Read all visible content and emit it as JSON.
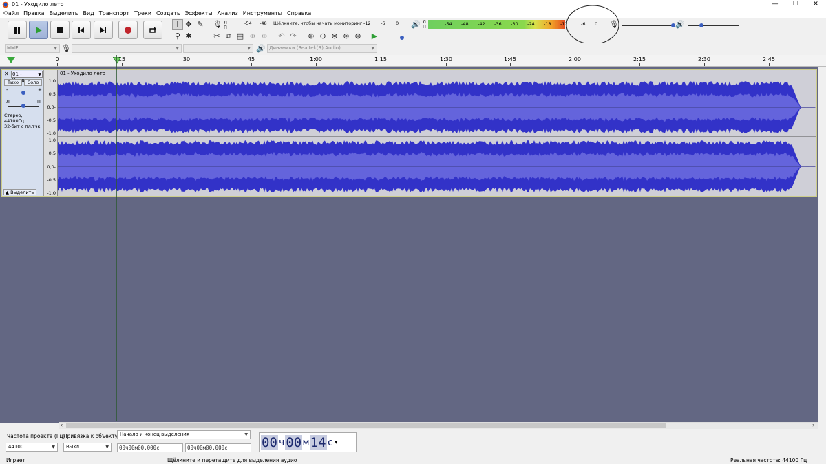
{
  "window": {
    "title": "01 - Уходило лето",
    "minimize": "—",
    "restore": "❐",
    "close": "✕"
  },
  "menu": [
    "Файл",
    "Правка",
    "Выделить",
    "Вид",
    "Транспорт",
    "Треки",
    "Создать",
    "Эффекты",
    "Анализ",
    "Инструменты",
    "Справка"
  ],
  "transport": {
    "pause": "pause-icon",
    "play": "play-icon",
    "stop": "stop-icon",
    "skip_start": "skip-start-icon",
    "skip_end": "skip-end-icon",
    "record": "record-icon",
    "loop": "loop-icon",
    "colors": {
      "record": "#c0242b",
      "play": "#2e9e34",
      "active_bg": "#a9bbdf"
    }
  },
  "rec_meter": {
    "ticks": [
      "-54",
      "-48",
      "-12",
      "-6",
      "0"
    ],
    "prompt": "Щёлкните, чтобы начать мониторинг",
    "L": "Л",
    "R": "П"
  },
  "play_meter": {
    "ticks": [
      "-54",
      "-48",
      "-42",
      "-36",
      "-30",
      "-24",
      "-18",
      "-12",
      "-6",
      "0"
    ],
    "L": "Л",
    "R": "П",
    "level": 0.83
  },
  "device": {
    "host": "MME",
    "recording_device": "",
    "channels": "",
    "playback_device": "Динамики (Realtek(R) Audio)"
  },
  "ruler": {
    "labels": [
      "0",
      "15",
      "30",
      "45",
      "1:00",
      "1:15",
      "1:30",
      "1:45",
      "2:00",
      "2:15",
      "2:30",
      "2:45"
    ]
  },
  "track": {
    "name": "01 - Уходило",
    "clip_name": "01 - Уходило лето",
    "mute": "Тихо",
    "solo": "Соло",
    "pan_left": "Л",
    "pan_right": "П",
    "info_line1": "Стерео, 44100Гц",
    "info_line2": "32-бит с пл.тчк.",
    "select": "Выделить",
    "scale": [
      "1,0",
      "0,5",
      "0,0-",
      "-0,5",
      "-1,0",
      "1,0",
      "0,5",
      "0,0-",
      "-0,5",
      "-1,0"
    ],
    "colors": {
      "wave": "#3232c8",
      "rms": "#6464dc",
      "bg": "#cfcfd7"
    }
  },
  "bottom": {
    "rate_label": "Частота проекта (Гц)",
    "rate_value": "44100",
    "snap_label": "Привязка к объекту",
    "snap_value": "Выкл",
    "sel_mode": "Начало и конец выделения",
    "sel_start": "00ч00м00.000с",
    "sel_end": "00ч00м00.000с",
    "time": {
      "h": "00",
      "hu": "ч",
      "m": "00",
      "mu": "м",
      "s": "14",
      "su": "с"
    }
  },
  "status": {
    "state": "Играет",
    "hint": "Щёлкните и перетащите для выделения аудио",
    "rate": "Реальная частота: 44100 Гц"
  }
}
